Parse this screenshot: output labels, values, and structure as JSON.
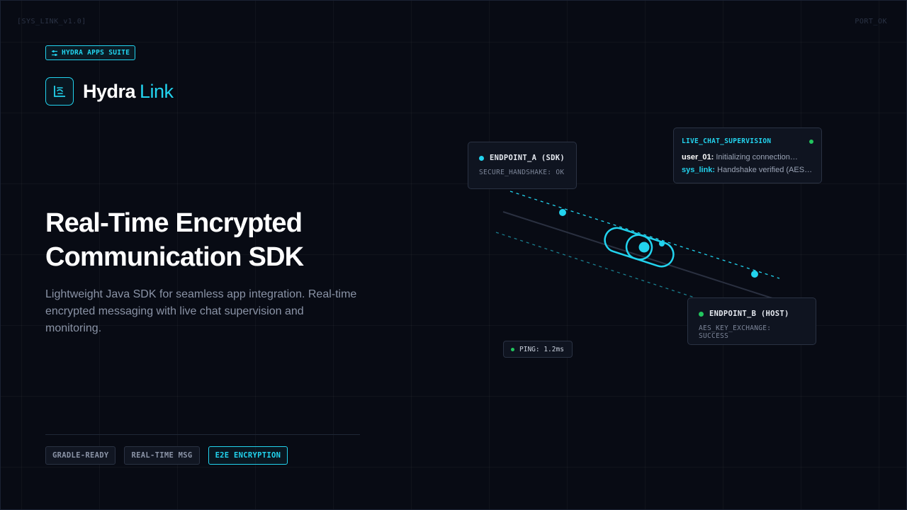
{
  "corners": {
    "left": "[SYS_LINK_v1.0]",
    "right": "PORT_OK"
  },
  "suite_badge": {
    "label": "HYDRA APPS SUITE",
    "icon": "sliders-icon"
  },
  "brand": {
    "name": "Hydra",
    "accent": "Link",
    "icon": "chart-logo-icon"
  },
  "hero": {
    "title_line1": "Real-Time Encrypted",
    "title_line2": "Communication SDK",
    "subtitle": "Lightweight Java SDK for seamless app integration. Real-time encrypted messaging with live chat supervision and monitoring."
  },
  "tags": [
    {
      "label": "GRADLE-READY",
      "active": false
    },
    {
      "label": "REAL-TIME MSG",
      "active": false
    },
    {
      "label": "E2E ENCRYPTION",
      "active": true
    }
  ],
  "endpoint_a": {
    "title": "ENDPOINT_A (SDK)",
    "status": "SECURE_HANDSHAKE: OK"
  },
  "endpoint_b": {
    "title": "ENDPOINT_B (HOST)",
    "status": "AES_KEY_EXCHANGE: SUCCESS"
  },
  "chat": {
    "title": "LIVE_CHAT_SUPERVISION",
    "lines": [
      {
        "who": "user_01:",
        "text": "Initializing connection…"
      },
      {
        "who": "sys_link:",
        "text": "Handshake verified (AES-…"
      }
    ]
  },
  "ping": {
    "label": "PING: 1.2ms"
  },
  "colors": {
    "accent": "#22d3ee",
    "online": "#22c55e",
    "background": "#080b14"
  }
}
